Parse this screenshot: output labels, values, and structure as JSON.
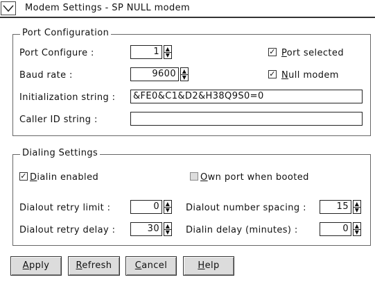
{
  "window": {
    "title": "Modem Settings - SP NULL modem"
  },
  "port_config": {
    "group_title": "Port Configuration",
    "port_configure": {
      "label": "Port Configure :",
      "value": "1"
    },
    "port_selected": {
      "mnemonic": "P",
      "rest": "ort selected",
      "checked": true
    },
    "baud_rate": {
      "label": "Baud rate :",
      "value": "9600"
    },
    "null_modem": {
      "mnemonic": "N",
      "rest": "ull modem",
      "checked": true
    },
    "init_string": {
      "label": "Initialization string :",
      "value": "&FE0&C1&D2&H38Q9S0=0"
    },
    "caller_id": {
      "label": "Caller ID string :",
      "value": ""
    }
  },
  "dialing": {
    "group_title": "Dialing Settings",
    "dialin_enabled": {
      "mnemonic": "D",
      "rest": "ialin enabled",
      "checked": true
    },
    "own_port": {
      "mnemonic": "O",
      "rest": "wn port when booted",
      "checked": false
    },
    "dialout_retry_limit": {
      "label": "Dialout retry limit :",
      "value": "0"
    },
    "dialout_number_spacing": {
      "label": "Dialout number spacing :",
      "value": "15"
    },
    "dialout_retry_delay": {
      "label": "Dialout retry delay :",
      "value": "30"
    },
    "dialin_delay": {
      "label": "Dialin delay (minutes) :",
      "value": "0"
    }
  },
  "buttons": {
    "apply": {
      "mnemonic": "A",
      "rest": "pply"
    },
    "refresh": {
      "mnemonic": "R",
      "rest": "efresh"
    },
    "cancel": {
      "mnemonic": "C",
      "rest": "ancel"
    },
    "help": {
      "mnemonic": "H",
      "rest": "elp"
    }
  },
  "glyphs": {
    "check": "✓",
    "spin_up": "▲",
    "spin_down": "▼"
  }
}
